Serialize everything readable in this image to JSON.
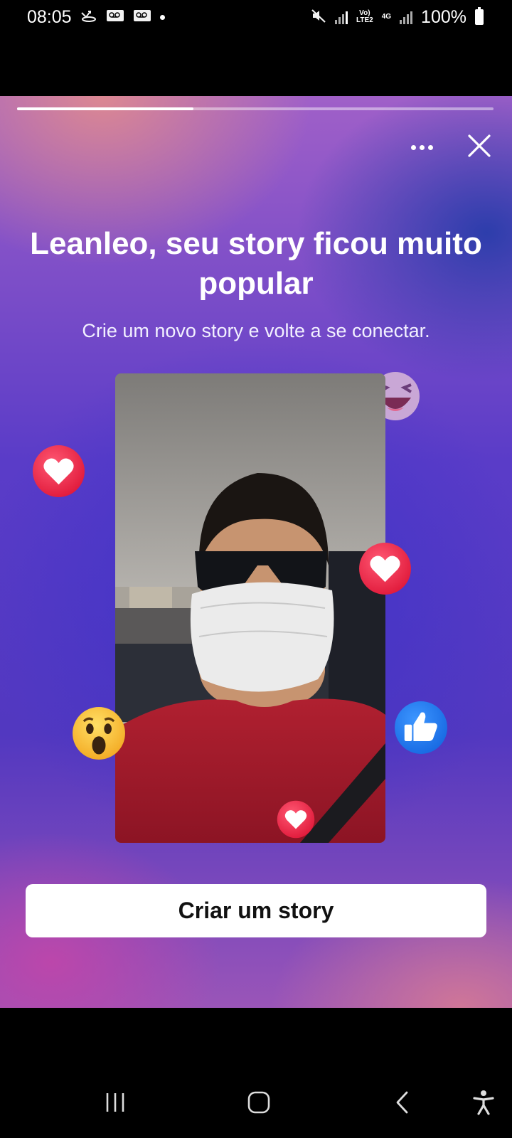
{
  "status_bar": {
    "time": "08:05",
    "battery": "100%",
    "network_top": "Vo)",
    "network_bottom": "LTE2",
    "network_gen": "4G"
  },
  "story": {
    "progress_fraction": 0.37,
    "title": "Leanleo, seu story ficou muito popular",
    "subtitle": "Crie um novo story e volte a se conectar.",
    "cta_label": "Criar um story",
    "reactions": [
      "laugh-reaction-icon",
      "love-reaction-icon",
      "love-reaction-icon",
      "wow-reaction-icon",
      "like-reaction-icon",
      "love-reaction-icon"
    ]
  },
  "colors": {
    "love": "#f0284a",
    "like": "#1877f2",
    "wow": "#f7b125",
    "cta_bg": "#ffffff"
  }
}
